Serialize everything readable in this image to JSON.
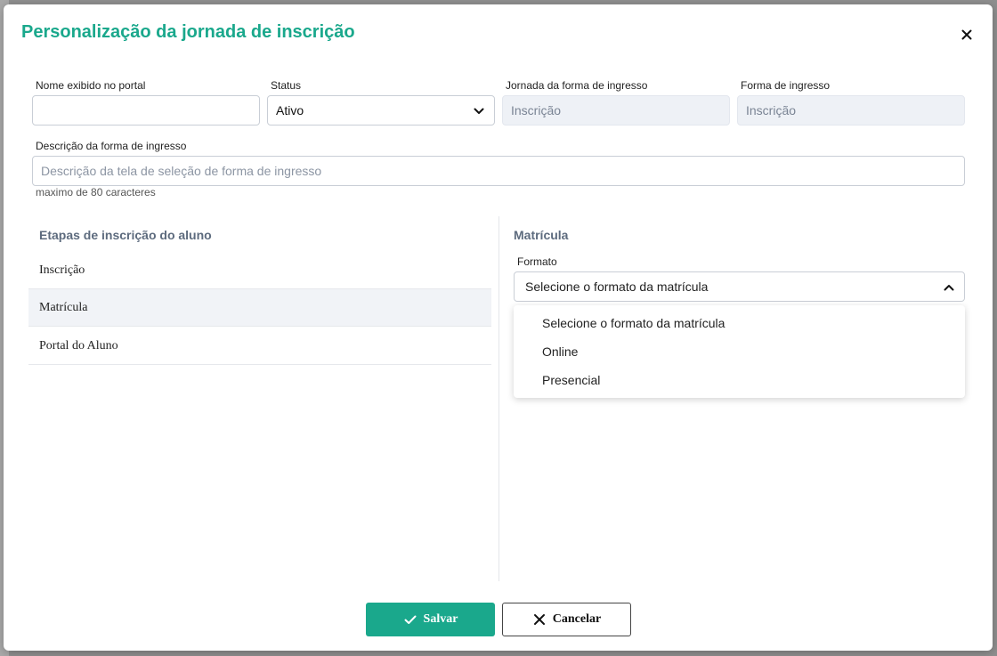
{
  "modal": {
    "title": "Personalização da jornada de inscrição"
  },
  "fields": {
    "portal_name": {
      "label": "Nome exibido no portal",
      "value": ""
    },
    "status": {
      "label": "Status",
      "value": "Ativo"
    },
    "journey": {
      "label": "Jornada da forma de ingresso",
      "value": "Inscrição"
    },
    "entry_form": {
      "label": "Forma de ingresso",
      "value": "Inscrição"
    },
    "description": {
      "label": "Descrição da forma de ingresso",
      "placeholder": "Descrição da tela de seleção de forma de ingresso",
      "hint": "maximo de 80 caracteres"
    }
  },
  "steps": {
    "heading": "Etapas de inscrição do aluno",
    "items": [
      {
        "label": "Inscrição"
      },
      {
        "label": "Matrícula"
      },
      {
        "label": "Portal do Aluno"
      }
    ]
  },
  "enrollment": {
    "heading": "Matrícula",
    "format_label": "Formato",
    "format_value": "Selecione o formato da matrícula",
    "options": [
      "Selecione o formato da matrícula",
      "Online",
      "Presencial"
    ]
  },
  "actions": {
    "save_label": "Salvar",
    "cancel_label": "Cancelar"
  },
  "colors": {
    "accent": "#1aa88c",
    "section_heading": "#5d6b7e",
    "disabled_bg": "#eef1f6"
  },
  "icons": {
    "close": "close-icon",
    "status_chevron": "chevron-down-icon",
    "format_chevron": "chevron-up-icon",
    "save": "check-icon",
    "cancel": "x-icon"
  }
}
